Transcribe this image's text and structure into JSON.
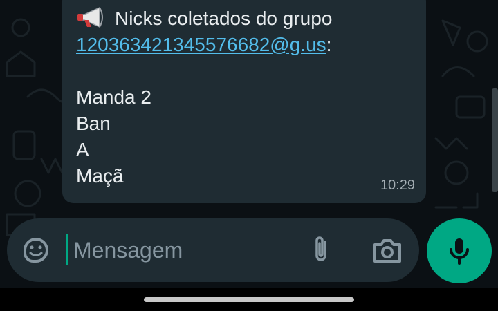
{
  "message": {
    "header_text": "Nicks coletados do grupo",
    "group_id_link": "120363421345576682@g.us",
    "group_id_suffix": ":",
    "nicks": [
      "Manda 2",
      "Ban",
      "A",
      "Maçã"
    ],
    "timestamp": "10:29",
    "icon": "loudspeaker-emoji"
  },
  "composer": {
    "placeholder": "Mensagem",
    "icons": [
      "sticker-icon",
      "paperclip-icon",
      "camera-icon",
      "microphone-icon"
    ]
  },
  "colors": {
    "bubble": "#1f2c33",
    "link": "#53bdeb",
    "accent": "#00a884",
    "background": "#0b1014"
  }
}
